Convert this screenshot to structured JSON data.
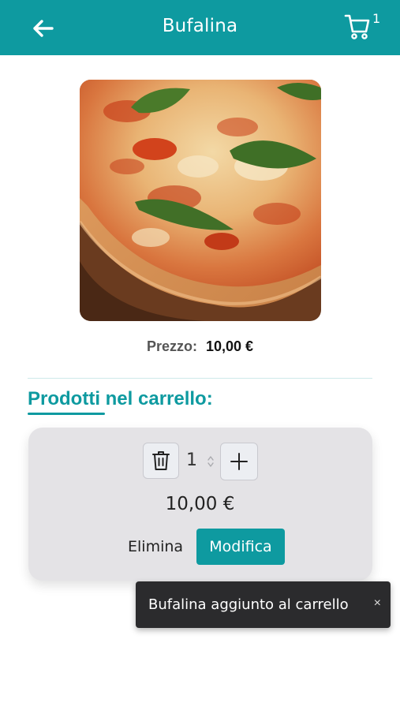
{
  "header": {
    "title": "Bufalina",
    "back_icon": "arrow-left-icon",
    "cart_icon": "shopping-cart-icon",
    "cart_count": "1",
    "accent_color": "#0e9aa0"
  },
  "product": {
    "image_alt": "pizza photo",
    "price_label": "Prezzo:",
    "price_value": "10,00 €"
  },
  "cart_section": {
    "title": "Prodotti nel carrello:",
    "item": {
      "quantity": "1",
      "trash_icon": "trash-icon",
      "plus_icon": "plus-icon",
      "line_total": "10,00 €",
      "delete_label": "Elimina",
      "edit_label": "Modifica"
    }
  },
  "toast": {
    "message": "Bufalina aggiunto al carrello",
    "close_label": "×"
  }
}
